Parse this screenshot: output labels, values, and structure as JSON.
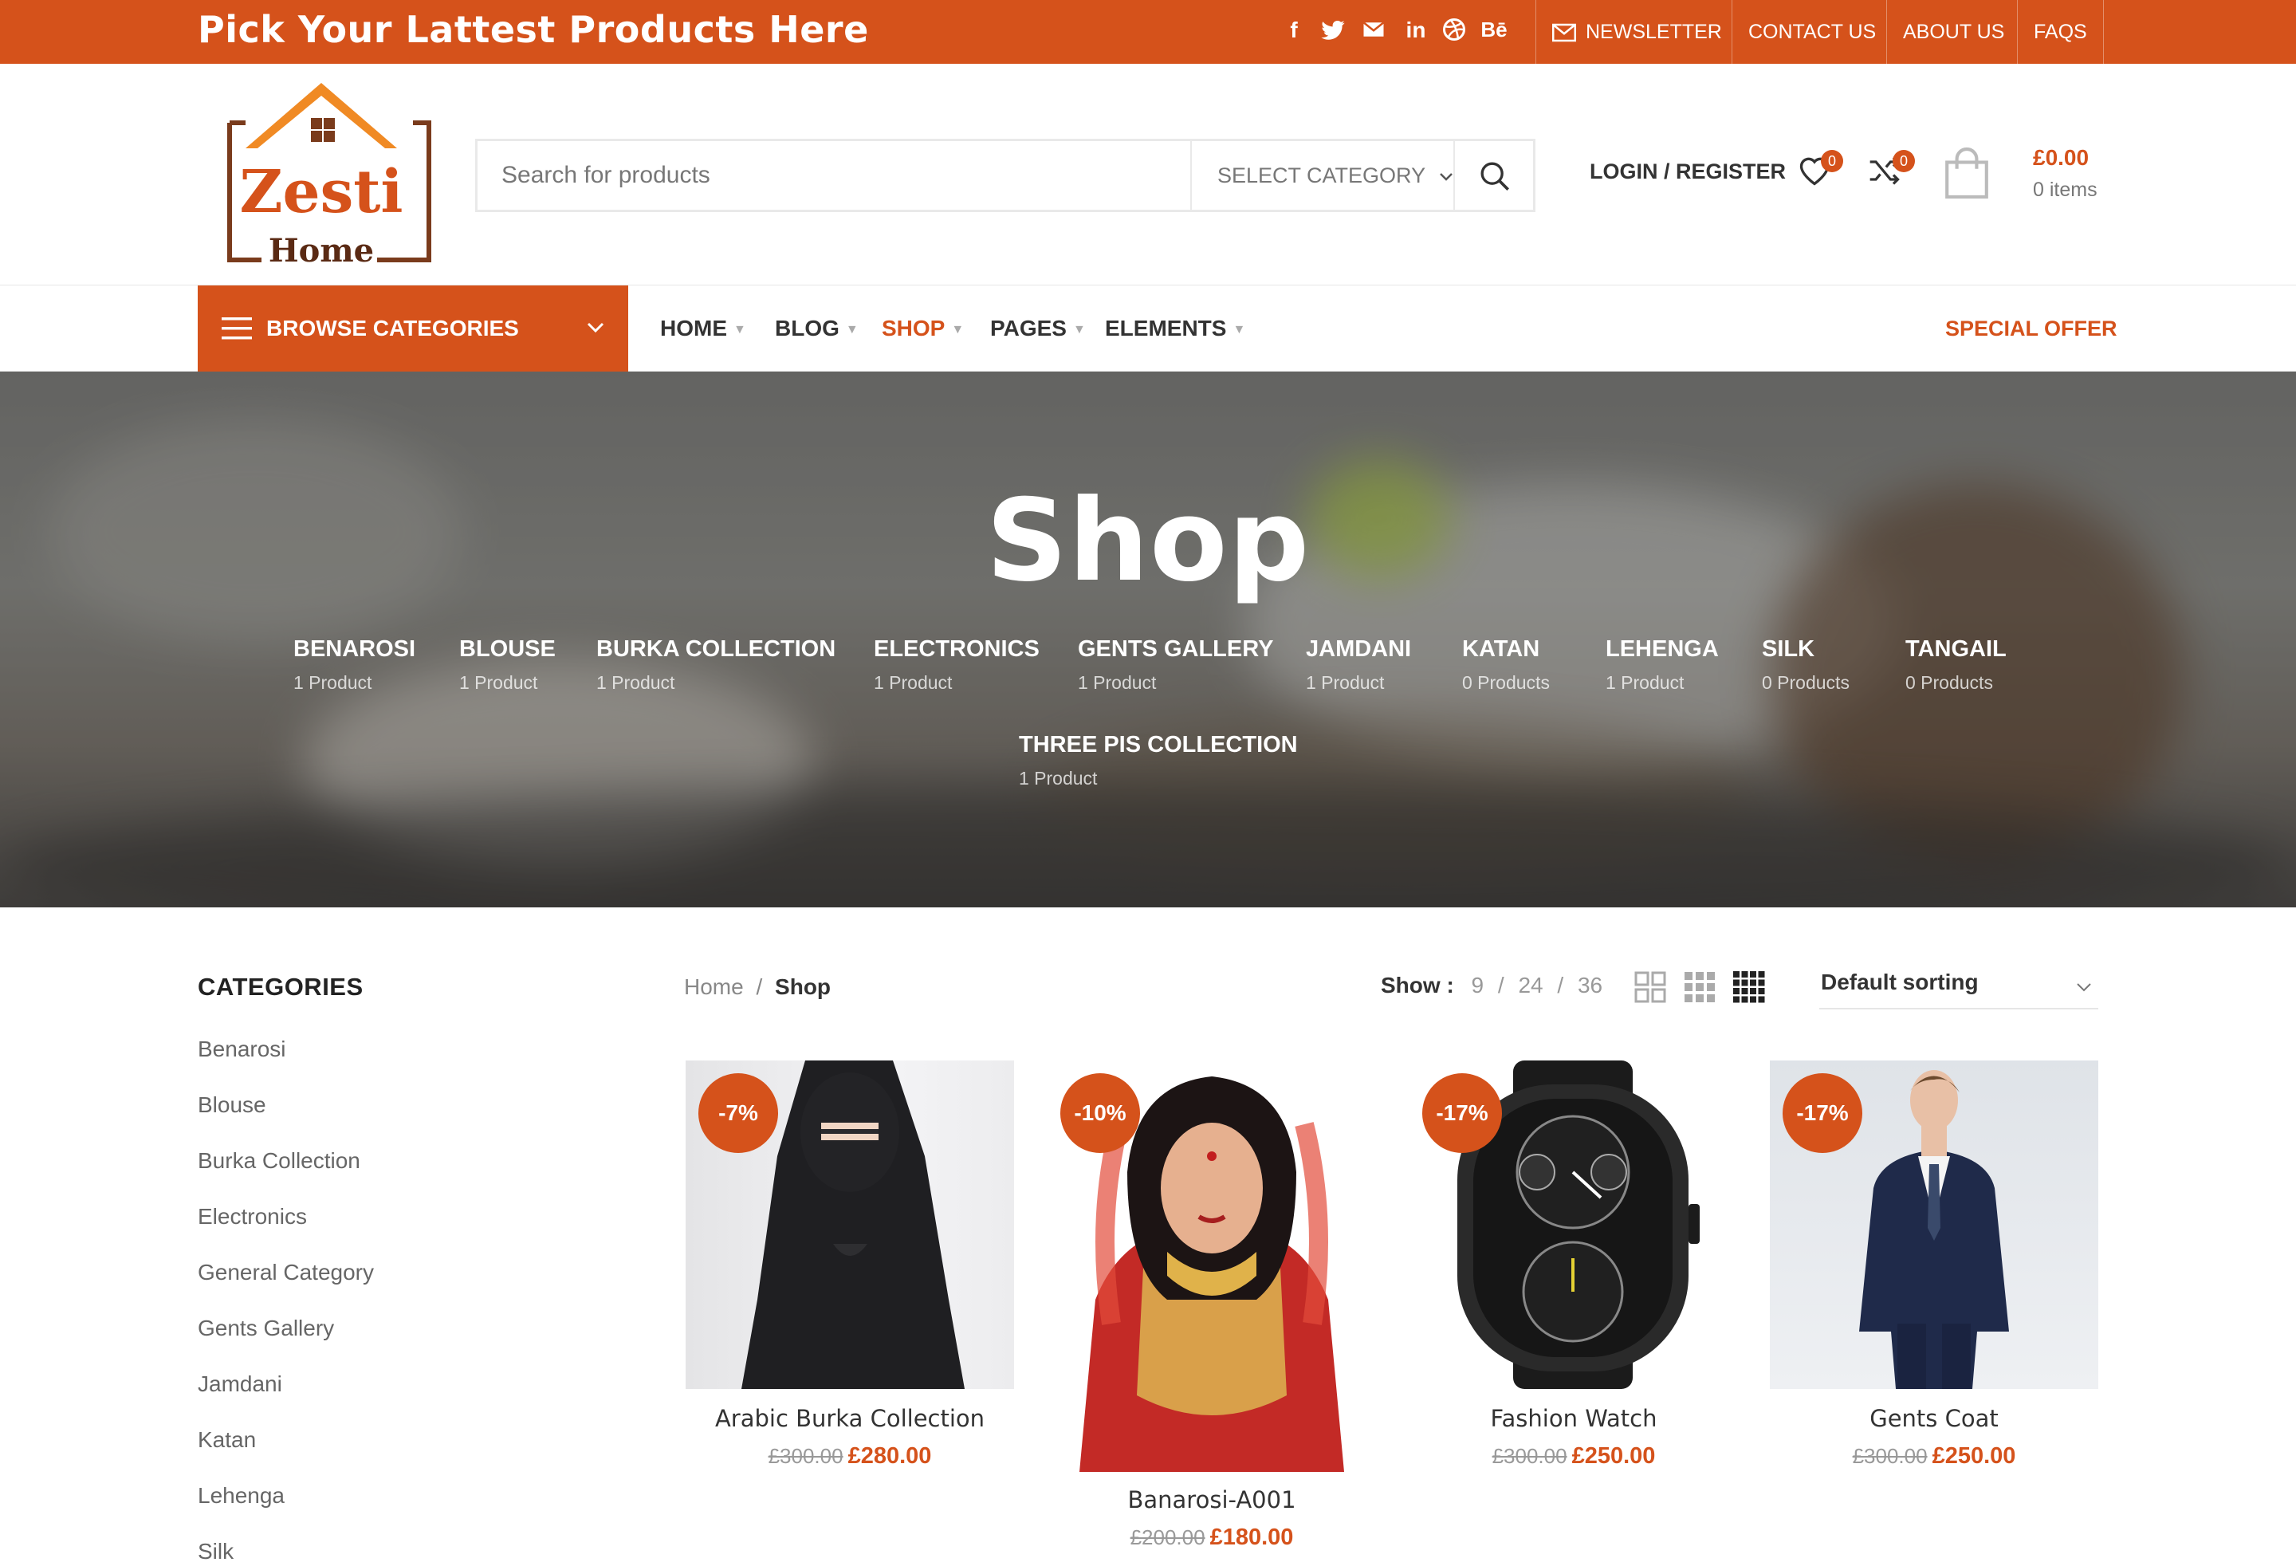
{
  "topbar": {
    "tagline": "Pick Your Lattest Products Here",
    "social": [
      "facebook-icon",
      "twitter-icon",
      "envelope-icon",
      "linkedin-icon",
      "dribbble-icon",
      "behance-icon"
    ],
    "social_glyphs": [
      "f",
      "",
      "",
      "in",
      "",
      "Bē"
    ],
    "links": [
      "NEWSLETTER",
      "CONTACT US",
      "ABOUT US",
      "FAQS"
    ]
  },
  "logo": {
    "word1": "Zesti",
    "word2": "Home"
  },
  "search": {
    "placeholder": "Search for products",
    "category": "SELECT CATEGORY"
  },
  "header": {
    "login": "LOGIN / REGISTER",
    "wishlist_count": "0",
    "compare_count": "0",
    "cart_amount": "£0.00",
    "cart_items": "0 items"
  },
  "nav": {
    "browse": "BROWSE CATEGORIES",
    "items": [
      "HOME",
      "BLOG",
      "SHOP",
      "PAGES",
      "ELEMENTS"
    ],
    "active": "SHOP",
    "special": "SPECIAL OFFER"
  },
  "hero": {
    "title": "Shop",
    "categories": [
      {
        "name": "BENAROSI",
        "count": "1 Product"
      },
      {
        "name": "BLOUSE",
        "count": "1 Product"
      },
      {
        "name": "BURKA COLLECTION",
        "count": "1 Product"
      },
      {
        "name": "ELECTRONICS",
        "count": "1 Product"
      },
      {
        "name": "GENTS GALLERY",
        "count": "1 Product"
      },
      {
        "name": "JAMDANI",
        "count": "1 Product"
      },
      {
        "name": "KATAN",
        "count": "0 Products"
      },
      {
        "name": "LEHENGA",
        "count": "1 Product"
      },
      {
        "name": "SILK",
        "count": "0 Products"
      },
      {
        "name": "TANGAIL",
        "count": "0 Products"
      },
      {
        "name": "THREE PIS COLLECTION",
        "count": "1 Product"
      }
    ]
  },
  "sidebar": {
    "title": "CATEGORIES",
    "items": [
      "Benarosi",
      "Blouse",
      "Burka Collection",
      "Electronics",
      "General Category",
      "Gents Gallery",
      "Jamdani",
      "Katan",
      "Lehenga",
      "Silk"
    ]
  },
  "toolbar": {
    "breadcrumb_home": "Home",
    "breadcrumb_sep": "/",
    "breadcrumb_current": "Shop",
    "show_label": "Show :",
    "show_options": [
      "9",
      "24",
      "36"
    ],
    "sort": "Default sorting"
  },
  "products": [
    {
      "name": "Arabic Burka Collection",
      "old": "£300.00",
      "new": "£280.00",
      "discount": "-7%"
    },
    {
      "name": "Banarosi-A001",
      "old": "£200.00",
      "new": "£180.00",
      "discount": "-10%"
    },
    {
      "name": "Fashion Watch",
      "old": "£300.00",
      "new": "£250.00",
      "discount": "-17%"
    },
    {
      "name": "Gents Coat",
      "old": "£300.00",
      "new": "£250.00",
      "discount": "-17%"
    }
  ],
  "colors": {
    "accent": "#d5521b",
    "text": "#333333",
    "muted": "#777777"
  }
}
